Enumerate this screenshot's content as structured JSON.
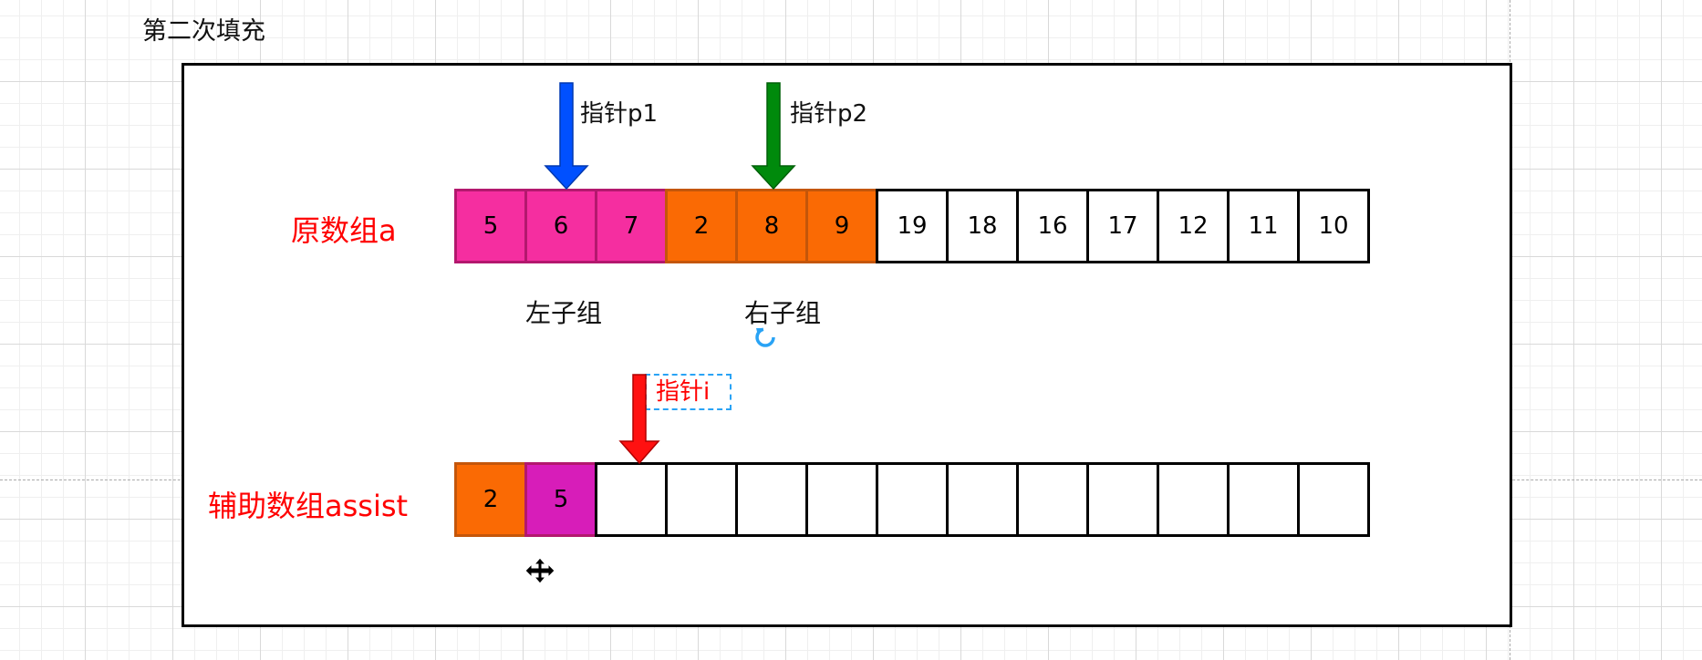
{
  "title": "第二次填充",
  "colors": {
    "left_group": "#f52ea0",
    "left_group_border": "#b3186e",
    "right_group": "#fa6a04",
    "right_group_border": "#c4560a",
    "assist_right": "#fa6a04",
    "assist_left": "#d71db9",
    "label_red": "#ff0000",
    "arrow_p1": "#0050ff",
    "arrow_p2": "#008a0c",
    "arrow_i": "#ff1111"
  },
  "array_a": {
    "label": "原数组a",
    "cells": [
      {
        "value": "5",
        "group": "left"
      },
      {
        "value": "6",
        "group": "left"
      },
      {
        "value": "7",
        "group": "left"
      },
      {
        "value": "2",
        "group": "right"
      },
      {
        "value": "8",
        "group": "right"
      },
      {
        "value": "9",
        "group": "right"
      },
      {
        "value": "19",
        "group": "none"
      },
      {
        "value": "18",
        "group": "none"
      },
      {
        "value": "16",
        "group": "none"
      },
      {
        "value": "17",
        "group": "none"
      },
      {
        "value": "12",
        "group": "none"
      },
      {
        "value": "11",
        "group": "none"
      },
      {
        "value": "10",
        "group": "none"
      }
    ]
  },
  "groups": {
    "left_label": "左子组",
    "right_label": "右子组"
  },
  "pointers": {
    "p1_label": "指针p1",
    "p2_label": "指针p2",
    "i_label": "指针i"
  },
  "array_assist": {
    "label": "辅助数组assist",
    "cells": [
      {
        "value": "2",
        "group": "right"
      },
      {
        "value": "5",
        "group": "left"
      },
      {
        "value": "",
        "group": "none"
      },
      {
        "value": "",
        "group": "none"
      },
      {
        "value": "",
        "group": "none"
      },
      {
        "value": "",
        "group": "none"
      },
      {
        "value": "",
        "group": "none"
      },
      {
        "value": "",
        "group": "none"
      },
      {
        "value": "",
        "group": "none"
      },
      {
        "value": "",
        "group": "none"
      },
      {
        "value": "",
        "group": "none"
      },
      {
        "value": "",
        "group": "none"
      },
      {
        "value": "",
        "group": "none"
      }
    ]
  },
  "editor_icons": [
    "rotate-handle-icon",
    "move-cursor-icon"
  ]
}
